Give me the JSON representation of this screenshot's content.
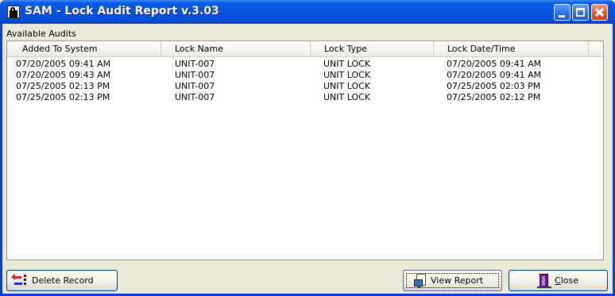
{
  "window": {
    "title": "SAM - Lock Audit Report v.3.03",
    "title_bar_color": "#0a4cd8"
  },
  "group": {
    "label": "Available Audits"
  },
  "table": {
    "columns": [
      "Added To System",
      "Lock Name",
      "Lock Type",
      "Lock Date/Time"
    ],
    "rows": [
      [
        "07/20/2005 09:41 AM",
        "UNIT-007",
        "UNIT LOCK",
        "07/20/2005 09:41 AM"
      ],
      [
        "07/20/2005 09:43 AM",
        "UNIT-007",
        "UNIT LOCK",
        "07/20/2005 09:41 AM"
      ],
      [
        "07/25/2005 02:13 PM",
        "UNIT-007",
        "UNIT LOCK",
        "07/25/2005 02:03 PM"
      ],
      [
        "07/25/2005 02:13 PM",
        "UNIT-007",
        "UNIT LOCK",
        "07/25/2005 02:12 PM"
      ]
    ]
  },
  "buttons": {
    "delete_label": "Delete Record",
    "view_label": "View Report",
    "close_label_mnemonic": "C",
    "close_label_rest": "lose"
  },
  "icons": {
    "app": "lock-icon",
    "delete": "delete-record-icon",
    "view": "view-report-icon",
    "close": "exit-door-icon"
  }
}
